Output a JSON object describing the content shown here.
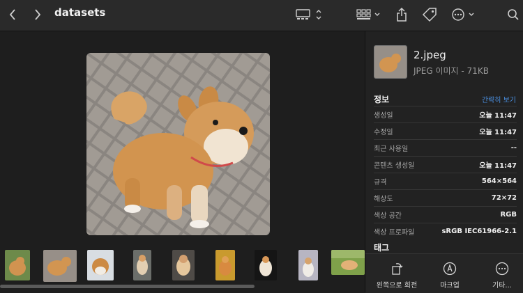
{
  "window": {
    "title": "datasets"
  },
  "toolbar": {
    "back_icon": "chevron-left-icon",
    "forward_icon": "chevron-right-icon",
    "view_icon": "gallery-view-icon",
    "group_icon": "grid-group-icon",
    "share_icon": "share-icon",
    "tag_icon": "tag-icon",
    "more_icon": "ellipsis-circle-icon",
    "search_icon": "search-icon"
  },
  "inspector": {
    "file_name": "2.jpeg",
    "file_kind": "JPEG 이미지 - 71KB",
    "info_title": "정보",
    "less_link": "간략히 보기",
    "rows": [
      {
        "label": "생성일",
        "value": "오늘 11:47"
      },
      {
        "label": "수정일",
        "value": "오늘 11:47"
      },
      {
        "label": "최근 사용일",
        "value": "--"
      },
      {
        "label": "콘텐츠 생성일",
        "value": "오늘 11:47"
      },
      {
        "label": "규격",
        "value": "564×564"
      },
      {
        "label": "해상도",
        "value": "72×72"
      },
      {
        "label": "색상 공간",
        "value": "RGB"
      },
      {
        "label": "색상 프로파일",
        "value": "sRGB IEC61966-2.1"
      }
    ],
    "tags_title": "태그"
  },
  "actions": {
    "rotate_left": "왼쪽으로 회전",
    "markup": "마크업",
    "more": "기타..."
  },
  "colors": {
    "accent": "#4a90e2",
    "background": "#1e1e1e",
    "panel": "#222222"
  }
}
